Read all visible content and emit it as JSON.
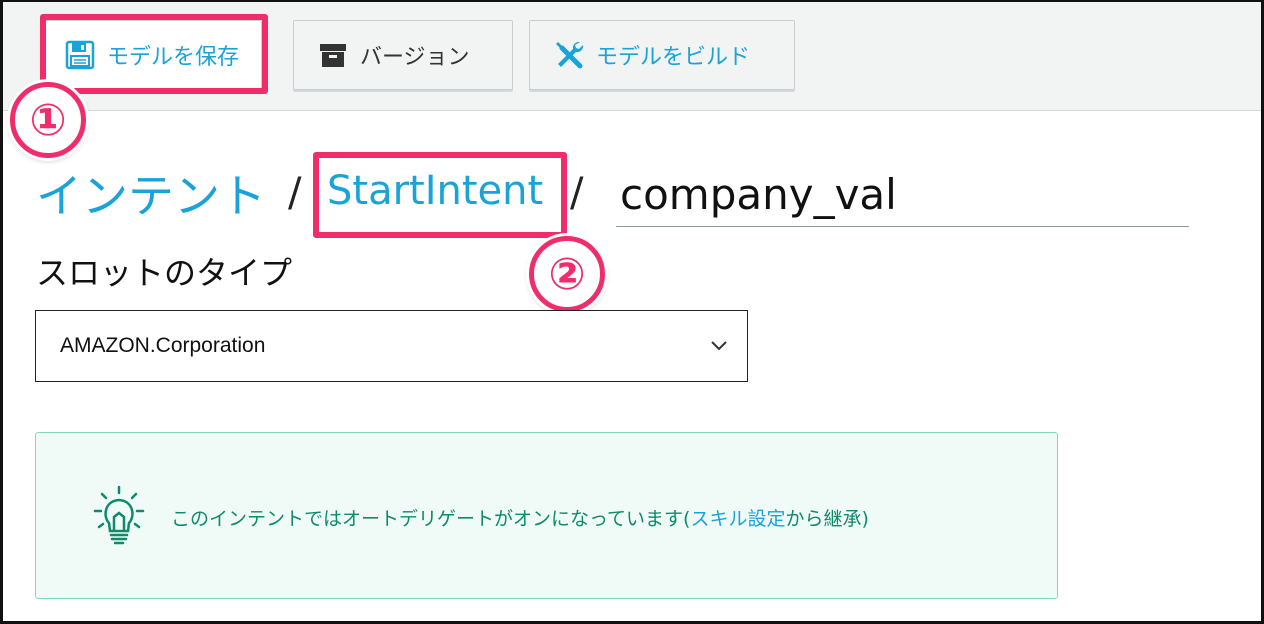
{
  "toolbar": {
    "save_label": "モデルを保存",
    "version_label": "バージョン",
    "build_label": "モデルをビルド"
  },
  "annotations": {
    "badge1": "①",
    "badge2": "②"
  },
  "breadcrumb": {
    "intents": "インテント",
    "separator": "/",
    "intent_name": "StartIntent"
  },
  "slot": {
    "name_value": "company_val",
    "type_label": "スロットのタイプ",
    "type_selected": "AMAZON.Corporation"
  },
  "info": {
    "text_before": "このインテントではオートデリゲートがオンになっています(",
    "link": "スキル設定",
    "text_after": "から継承)"
  },
  "colors": {
    "accent": "#1aa3d8",
    "highlight": "#ef2d6a",
    "info_text": "#0f8a6a",
    "info_bg": "#f0fbf8"
  }
}
